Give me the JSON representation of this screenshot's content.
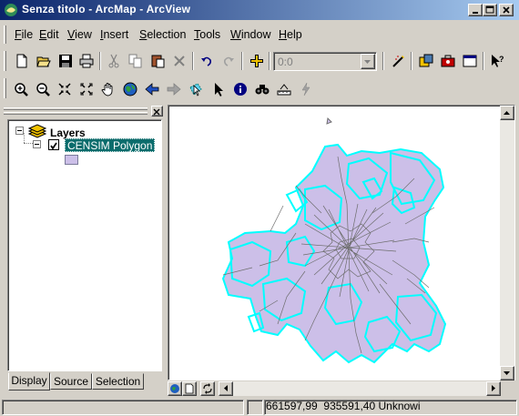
{
  "window": {
    "title": "Senza titolo - ArcMap - ArcView",
    "controls": [
      "minimize",
      "maximize",
      "close"
    ]
  },
  "menubar": {
    "items": [
      {
        "label": "File",
        "mnemonic": "F"
      },
      {
        "label": "Edit",
        "mnemonic": "E"
      },
      {
        "label": "View",
        "mnemonic": "V"
      },
      {
        "label": "Insert",
        "mnemonic": "I"
      },
      {
        "label": "Selection",
        "mnemonic": "S"
      },
      {
        "label": "Tools",
        "mnemonic": "T"
      },
      {
        "label": "Window",
        "mnemonic": "W"
      },
      {
        "label": "Help",
        "mnemonic": "H"
      }
    ]
  },
  "standard_toolbar": {
    "buttons": [
      "new-icon",
      "open-icon",
      "save-icon",
      "print-icon",
      "cut-icon",
      "copy-icon",
      "paste-icon",
      "delete-icon",
      "undo-icon",
      "redo-icon",
      "add-data-icon"
    ],
    "scale_value": "0:0",
    "extra_buttons": [
      "editor-toolbar-icon",
      "arccatalog-icon",
      "arctoolbox-icon",
      "command-line-icon",
      "whats-this-icon"
    ]
  },
  "tools_toolbar": {
    "buttons": [
      "zoom-in-icon",
      "zoom-out-icon",
      "fixed-zoom-in-icon",
      "fixed-zoom-out-icon",
      "pan-icon",
      "full-extent-icon",
      "back-extent-icon",
      "forward-extent-icon",
      "select-features-icon",
      "select-elements-icon",
      "identify-icon",
      "find-icon",
      "measure-icon",
      "hyperlink-icon"
    ]
  },
  "toc": {
    "root_label": "Layers",
    "layers": [
      {
        "name": "CENSIM Polygon",
        "checked": true,
        "fill_color": "#ccbfe8"
      }
    ],
    "tabs": [
      {
        "label": "Display",
        "active": true
      },
      {
        "label": "Source",
        "active": false
      },
      {
        "label": "Selection",
        "active": false
      }
    ]
  },
  "map": {
    "polygon_fill": "#ccbfe8",
    "outline_color": "#00ffff",
    "interior_line_color": "#6e6e6e"
  },
  "status": {
    "x": "661597,99",
    "y": "935591,40",
    "units": "Unknowi"
  }
}
